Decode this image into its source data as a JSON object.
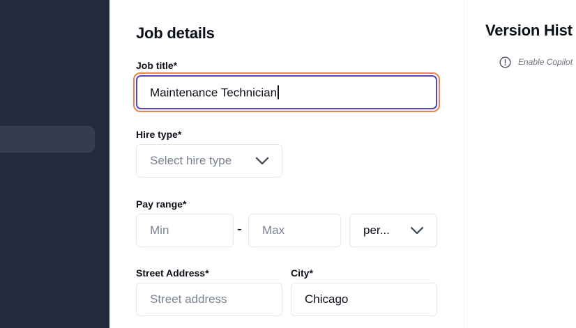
{
  "job_details": {
    "heading": "Job details",
    "job_title": {
      "label": "Job title*",
      "value": "Maintenance Technician"
    },
    "hire_type": {
      "label": "Hire type*",
      "placeholder": "Select hire type"
    },
    "pay_range": {
      "label": "Pay range*",
      "min_placeholder": "Min",
      "separator": "-",
      "max_placeholder": "Max",
      "period_value": "per..."
    },
    "street_address": {
      "label": "Street Address*",
      "placeholder": "Street address"
    },
    "city": {
      "label": "City*",
      "value": "Chicago"
    }
  },
  "version_history": {
    "heading": "Version Hist",
    "info_text": "Enable Copilot",
    "info_icon": "info-circle-icon"
  },
  "colors": {
    "sidebar_bg": "#222a3c",
    "sidebar_item_bg": "#343c4d",
    "focus_border": "#5b43c7",
    "focus_ring": "#e8844a"
  }
}
